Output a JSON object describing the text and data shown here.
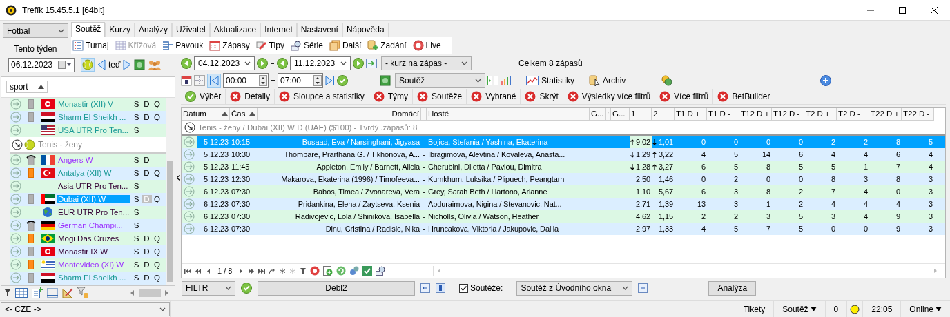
{
  "window": {
    "title": "Trefík 15.45.5.1 [64bit]"
  },
  "sport_select": {
    "value": "Fotbal"
  },
  "period_label": "Tento týden",
  "menu_tabs": [
    {
      "label": "Soutěž",
      "selected": true
    },
    {
      "label": "Kurzy",
      "selected": false
    },
    {
      "label": "Analýzy",
      "selected": false
    },
    {
      "label": "Uživatel",
      "selected": false
    },
    {
      "label": "Aktualizace",
      "selected": false
    },
    {
      "label": "Internet",
      "selected": false
    },
    {
      "label": "Nastavení",
      "selected": false
    },
    {
      "label": "Nápověda",
      "selected": false
    }
  ],
  "toolbar": [
    {
      "label": "Turnaj",
      "kind": "list",
      "disabled": false
    },
    {
      "label": "Křížová",
      "kind": "grid",
      "disabled": true
    },
    {
      "label": "Pavouk",
      "kind": "bracket",
      "disabled": false
    },
    {
      "label": "Zápasy",
      "kind": "calendar",
      "disabled": false
    },
    {
      "label": "Tipy",
      "kind": "pencil",
      "disabled": false
    },
    {
      "label": "Série",
      "kind": "magnifier",
      "disabled": false
    },
    {
      "label": "Další",
      "kind": "pages",
      "disabled": false
    },
    {
      "label": "Zadání",
      "kind": "add",
      "disabled": false
    },
    {
      "label": "Live",
      "kind": "live",
      "disabled": false
    }
  ],
  "left": {
    "date": "06.12.2023",
    "ball_pressed": true,
    "now_label": "teď",
    "sort_column": "sport",
    "rows": [
      {
        "kind": "competition",
        "name": "Monastir (XII) V",
        "marker": {
          "kind": "grey"
        },
        "flag": {
          "kind": "tn"
        },
        "color": "#1a9a96",
        "letters": [
          "S",
          "D",
          "Q"
        ],
        "selected": false
      },
      {
        "kind": "competition",
        "name": "Sharm El Sheikh ...",
        "marker": {
          "kind": "grey"
        },
        "flag": {
          "kind": "eg"
        },
        "color": "#1a9a96",
        "letters": [
          "S",
          "D",
          "Q"
        ],
        "selected": false
      },
      {
        "kind": "competition",
        "name": "USA UTR Pro Ten...",
        "marker": {
          "kind": "none"
        },
        "flag": {
          "kind": "us"
        },
        "color": "#1a9a96",
        "letters": [
          "S"
        ],
        "selected": false
      },
      {
        "kind": "group",
        "name": "Tenis - ženy"
      },
      {
        "kind": "competition",
        "name": "Angers W",
        "marker": {
          "kind": "hat"
        },
        "flag": {
          "kind": "fr"
        },
        "color": "#9b30ff",
        "letters": [
          "S",
          "D"
        ],
        "selected": false
      },
      {
        "kind": "competition",
        "name": "Antalya (XII) W",
        "marker": {
          "kind": "orange"
        },
        "flag": {
          "kind": "tr"
        },
        "color": "#1a9a96",
        "letters": [
          "S",
          "D",
          "Q"
        ],
        "selected": false
      },
      {
        "kind": "competition",
        "name": "Asia UTR Pro Ten...",
        "marker": {
          "kind": "none"
        },
        "flag": {
          "kind": "none"
        },
        "color": "#330033",
        "letters": [
          "S"
        ],
        "selected": false
      },
      {
        "kind": "competition",
        "name": "Dubai (XII) W",
        "marker": {
          "kind": "grey"
        },
        "flag": {
          "kind": "ae"
        },
        "letters": [
          "S",
          "D",
          "Q"
        ],
        "selected": true
      },
      {
        "kind": "competition",
        "name": "EUR UTR Pro Ten...",
        "marker": {
          "kind": "none"
        },
        "flag": {
          "kind": "globe"
        },
        "color": "#330033",
        "letters": [
          "S"
        ],
        "selected": false
      },
      {
        "kind": "competition",
        "name": "German Champi...",
        "marker": {
          "kind": "hat"
        },
        "flag": {
          "kind": "de"
        },
        "color": "#9b30ff",
        "letters": [
          "S"
        ],
        "selected": false
      },
      {
        "kind": "competition",
        "name": "Mogi Das Cruzes",
        "marker": {
          "kind": "orange"
        },
        "flag": {
          "kind": "br"
        },
        "color": "#330033",
        "letters": [
          "S",
          "D",
          "Q"
        ],
        "selected": false
      },
      {
        "kind": "competition",
        "name": "Monastir IX W",
        "marker": {
          "kind": "grey"
        },
        "flag": {
          "kind": "tn"
        },
        "color": "#330033",
        "letters": [
          "S",
          "D",
          "Q"
        ],
        "selected": false
      },
      {
        "kind": "competition",
        "name": "Montevideo (XI) W",
        "marker": {
          "kind": "orange"
        },
        "flag": {
          "kind": "uy"
        },
        "color": "#9b30ff",
        "letters": [
          "S",
          "D",
          "Q"
        ],
        "selected": false
      },
      {
        "kind": "competition",
        "name": "Sharm El Sheikh ...",
        "marker": {
          "kind": "grey"
        },
        "flag": {
          "kind": "eg"
        },
        "color": "#1a9a96",
        "letters": [
          "S",
          "D",
          "Q"
        ],
        "selected": false
      }
    ],
    "region_select": "<- CZE ->"
  },
  "filters": {
    "date_from": "04.12.2023",
    "date_to": "11.12.2023",
    "odds_select": "- kurz na zápas -",
    "total": "Celkem 8 zápasů",
    "first_pressed": true,
    "time_from": "00:00",
    "time_to": "07:00",
    "group_select": "Soutěž",
    "buttons": [
      {
        "label": "Statistiky",
        "kind": "chart"
      },
      {
        "label": "Archiv",
        "kind": "archive"
      }
    ]
  },
  "filter_tabs": [
    {
      "label": "Výběr",
      "kind": "ok"
    },
    {
      "label": "Detaily",
      "kind": "remove"
    },
    {
      "label": "Sloupce a statistiky",
      "kind": "remove"
    },
    {
      "label": "Týmy",
      "kind": "remove"
    },
    {
      "label": "Soutěže",
      "kind": "remove"
    },
    {
      "label": "Vybrané",
      "kind": "remove"
    },
    {
      "label": "Skrýt",
      "kind": "remove"
    },
    {
      "label": "Výsledky více filtrů",
      "kind": "remove"
    },
    {
      "label": "Více filtrů",
      "kind": "remove"
    },
    {
      "label": "BetBuilder",
      "kind": "remove"
    }
  ],
  "table": {
    "columns": [
      {
        "label": "Datum",
        "sorted": true
      },
      {
        "label": "Čas",
        "sorted": true
      },
      {
        "label": "Domácí",
        "sorted": false
      },
      {
        "label": "Hosté",
        "sorted": false
      },
      {
        "label": "G...",
        "sorted": false
      },
      {
        "label": ":",
        "sorted": false
      },
      {
        "label": "G...",
        "sorted": false
      },
      {
        "label": "1",
        "sorted": false
      },
      {
        "label": "2",
        "sorted": false
      },
      {
        "label": "T1 D +",
        "sorted": false
      },
      {
        "label": "T1 D -",
        "sorted": false
      },
      {
        "label": "T12 D +",
        "sorted": false
      },
      {
        "label": "T12 D -",
        "sorted": false
      },
      {
        "label": "T2 D +",
        "sorted": false
      },
      {
        "label": "T2 D -",
        "sorted": false
      },
      {
        "label": "T22 D +",
        "sorted": false
      },
      {
        "label": "T22 D -",
        "sorted": false
      }
    ],
    "group": {
      "label": "Tenis - ženy / Dubai (XII) W D (UAE)  ($100) - Tvrdý .zápasů: 8"
    },
    "rows": [
      {
        "date": "5.12.23",
        "time": "10:15",
        "home": "Busaad, Eva / Narsinghani, Jigyasa",
        "vs": "-",
        "away": "Bojica, Stefania / Yashina, Ekaterina",
        "odd1": "9,02",
        "trend1": {
          "kind": "up"
        },
        "odd2": "1,01",
        "trend2": {
          "kind": "down"
        },
        "stats": [
          "0",
          "0",
          "0",
          "0",
          "2",
          "2",
          "8",
          "5"
        ],
        "selected": true
      },
      {
        "date": "5.12.23",
        "time": "10:30",
        "home": "Thombare, Prarthana G. / Tikhonova, A...",
        "vs": "-",
        "away": "Ibragimova, Alevtina / Kovaleva, Anasta...",
        "odd1": "1,29",
        "trend1": {
          "kind": "down"
        },
        "odd2": "3,22",
        "trend2": {
          "kind": "up"
        },
        "stats": [
          "4",
          "5",
          "14",
          "6",
          "4",
          "4",
          "6",
          "4"
        ],
        "selected": false
      },
      {
        "date": "5.12.23",
        "time": "11:45",
        "home": "Appleton, Emily / Barnett, Alicia",
        "vs": "-",
        "away": "Cherubini, Diletta / Pavlou, Dimitra",
        "odd1": "1,28",
        "trend1": {
          "kind": "down"
        },
        "odd2": "3,27",
        "trend2": {
          "kind": "up"
        },
        "stats": [
          "6",
          "5",
          "8",
          "5",
          "5",
          "1",
          "7",
          "4"
        ],
        "selected": false
      },
      {
        "date": "5.12.23",
        "time": "12:30",
        "home": "Makarova, Ekaterina (1996) / Timofeeva...",
        "vs": "-",
        "away": "Kumkhum, Luksika / Plipuech, Peangtarn",
        "odd1": "2,50",
        "odd2": "1,46",
        "stats": [
          "0",
          "2",
          "0",
          "0",
          "8",
          "3",
          "8",
          "3"
        ],
        "selected": false
      },
      {
        "date": "6.12.23",
        "time": "07:30",
        "home": "Babos, Timea / Zvonareva, Vera",
        "vs": "-",
        "away": "Grey, Sarah Beth / Hartono, Arianne",
        "odd1": "1,10",
        "odd2": "5,67",
        "stats": [
          "6",
          "3",
          "8",
          "2",
          "7",
          "4",
          "0",
          "3"
        ],
        "selected": false
      },
      {
        "date": "6.12.23",
        "time": "07:30",
        "home": "Pridankina, Elena / Zaytseva, Ksenia",
        "vs": "-",
        "away": "Abduraimova, Nigina / Stevanovic, Nat...",
        "odd1": "2,71",
        "odd2": "1,39",
        "stats": [
          "13",
          "3",
          "1",
          "2",
          "4",
          "4",
          "4",
          "3"
        ],
        "selected": false
      },
      {
        "date": "6.12.23",
        "time": "07:30",
        "home": "Radivojevic, Lola / Shinikova, Isabella",
        "vs": "-",
        "away": "Nicholls, Olivia / Watson, Heather",
        "odd1": "4,62",
        "odd2": "1,15",
        "stats": [
          "2",
          "2",
          "3",
          "5",
          "3",
          "4",
          "9",
          "3"
        ],
        "selected": false
      },
      {
        "date": "6.12.23",
        "time": "07:30",
        "home": "Dinu, Cristina / Radisic, Nika",
        "vs": "-",
        "away": "Hruncakova, Viktoria / Jakupovic, Dalila",
        "odd1": "2,97",
        "odd2": "1,33",
        "stats": [
          "4",
          "5",
          "7",
          "5",
          "0",
          "0",
          "9",
          "3"
        ],
        "selected": false
      }
    ]
  },
  "pager": {
    "page": "1 / 8"
  },
  "bottom": {
    "filter_select": "FILTR",
    "filter_name": "Debl2",
    "competitions_checked": true,
    "competitions_label": "Soutěže:",
    "competitions_select": "Soutěž z Úvodního okna",
    "analysis_button": "Analýza"
  },
  "status_bar": {
    "items": [
      {
        "label": "Tikety",
        "dropdown": false
      },
      {
        "label": "Soutěž",
        "dropdown": true
      },
      {
        "label": "0",
        "dropdown": false
      }
    ],
    "time": "22:05",
    "connection": {
      "label": "Online",
      "dropdown": true
    }
  }
}
